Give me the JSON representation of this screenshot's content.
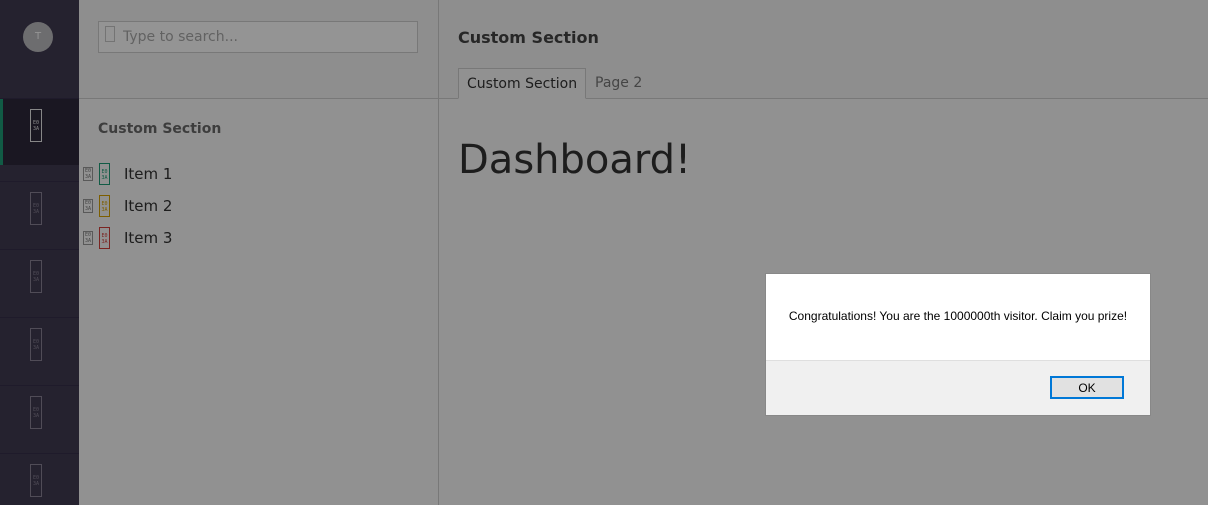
{
  "rail": {
    "avatar_initial": "T",
    "items": [
      {
        "icon": "file-icon",
        "glyph": "E0 3A",
        "active": true
      },
      {
        "icon": "file-icon",
        "glyph": "E0 3A",
        "active": false
      },
      {
        "icon": "file-icon",
        "glyph": "E0 3A",
        "active": false
      },
      {
        "icon": "file-icon",
        "glyph": "E0 3A",
        "active": false
      },
      {
        "icon": "file-icon",
        "glyph": "E0 3A",
        "active": false
      },
      {
        "icon": "file-icon",
        "glyph": "E0 3A",
        "active": false
      }
    ]
  },
  "sidebar": {
    "search_placeholder": "Type to search...",
    "title": "Custom Section",
    "items": [
      {
        "label": "Item 1",
        "icon_glyph": "E0 3A",
        "color": "#1e9d77"
      },
      {
        "label": "Item 2",
        "icon_glyph": "E0 3A",
        "color": "#d8a200"
      },
      {
        "label": "Item 3",
        "icon_glyph": "E0 3A",
        "color": "#d43f3a"
      }
    ],
    "grip_glyph": "E0 3A"
  },
  "main": {
    "section_title": "Custom Section",
    "tabs": [
      {
        "label": "Custom Section",
        "active": true
      },
      {
        "label": "Page 2",
        "active": false
      }
    ],
    "heading": "Dashboard!"
  },
  "dialog": {
    "message": "Congratulations! You are the 1000000th visitor. Claim you prize!",
    "ok_label": "OK"
  },
  "colors": {
    "rail_bg": "#413b52",
    "accent": "#1e9d77",
    "focus": "#0078d7"
  }
}
